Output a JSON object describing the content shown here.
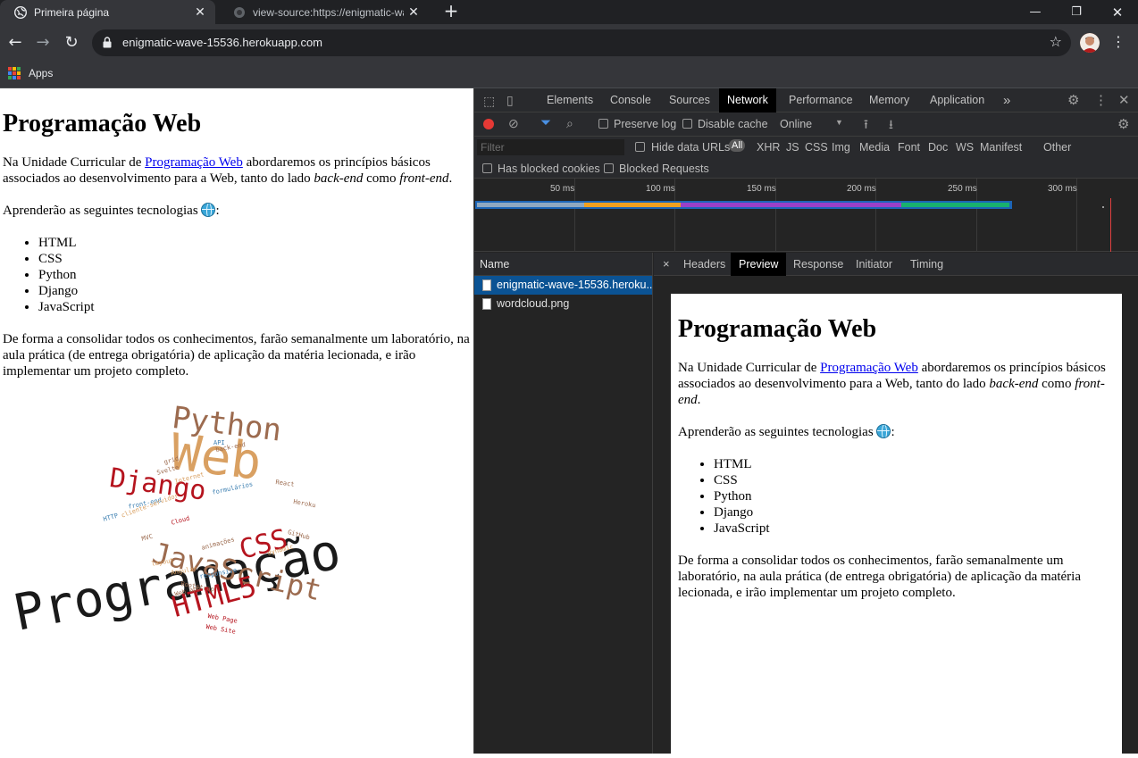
{
  "browser": {
    "tabs": [
      {
        "title": "Primeira página",
        "active": true
      },
      {
        "title": "view-source:https://enigmatic-wa",
        "active": false
      }
    ],
    "url": "enigmatic-wave-15536.herokuapp.com",
    "bookmarks": {
      "apps_label": "Apps"
    }
  },
  "page": {
    "title": "Programação Web",
    "intro_before": "Na Unidade Curricular de ",
    "intro_link": "Programação Web",
    "intro_after": " abordaremos os princípios básicos associados ao desenvolvimento para a Web, tanto do lado ",
    "intro_em1": "back-end",
    "intro_mid": " como ",
    "intro_em2": "front-end",
    "intro_end": ".",
    "tech_intro": "Aprenderão as seguintes tecnologias",
    "tech_colon": ":",
    "technologies": [
      "HTML",
      "CSS",
      "Python",
      "Django",
      "JavaScript"
    ],
    "closing": "De forma a consolidar todos os conhecimentos, farão semanalmente um laboratório, na aula prática (de entrega obrigatória) de aplicação da matéria lecionada, e irão implementar um projeto completo.",
    "wordcloud": {
      "words": [
        "Programação",
        "Web",
        "Python",
        "Django",
        "JavaScript",
        "CSS",
        "HTML5",
        "back-end",
        "API",
        "grid",
        "Svelte",
        "Internet",
        "formulários",
        "React",
        "Heroku",
        "front-end",
        "HTTP",
        "cliente-servidor",
        "Cloud",
        "GitHub",
        "dynamic",
        "MVC",
        "animações",
        "layout",
        "Angular",
        "responsive",
        "Bootstrap",
        "Web app",
        "Web Page",
        "Web Site"
      ],
      "colors": {
        "dark": "#1a1a1a",
        "brown": "#9c6b4f",
        "tan": "#d9a062",
        "red": "#b5141e",
        "blue": "#3c7fb1"
      }
    }
  },
  "devtools": {
    "tabs": [
      "Elements",
      "Console",
      "Sources",
      "Network",
      "Performance",
      "Memory",
      "Application"
    ],
    "active_tab": "Network",
    "more": "»",
    "toolbar": {
      "preserve_log": "Preserve log",
      "disable_cache": "Disable cache",
      "throttle": "Online"
    },
    "filter": {
      "placeholder": "Filter",
      "hide_data_urls": "Hide data URLs",
      "types": [
        "All",
        "XHR",
        "JS",
        "CSS",
        "Img",
        "Media",
        "Font",
        "Doc",
        "WS",
        "Manifest",
        "Other"
      ],
      "has_blocked_cookies": "Has blocked cookies",
      "blocked_requests": "Blocked Requests"
    },
    "timeline": {
      "ticks": [
        "50 ms",
        "100 ms",
        "150 ms",
        "200 ms",
        "250 ms",
        "300 ms"
      ]
    },
    "requests": {
      "header": "Name",
      "items": [
        "enigmatic-wave-15536.heroku...",
        "wordcloud.png"
      ]
    },
    "detail": {
      "close": "×",
      "tabs": [
        "Headers",
        "Preview",
        "Response",
        "Initiator",
        "Timing"
      ],
      "active_tab": "Preview"
    }
  }
}
